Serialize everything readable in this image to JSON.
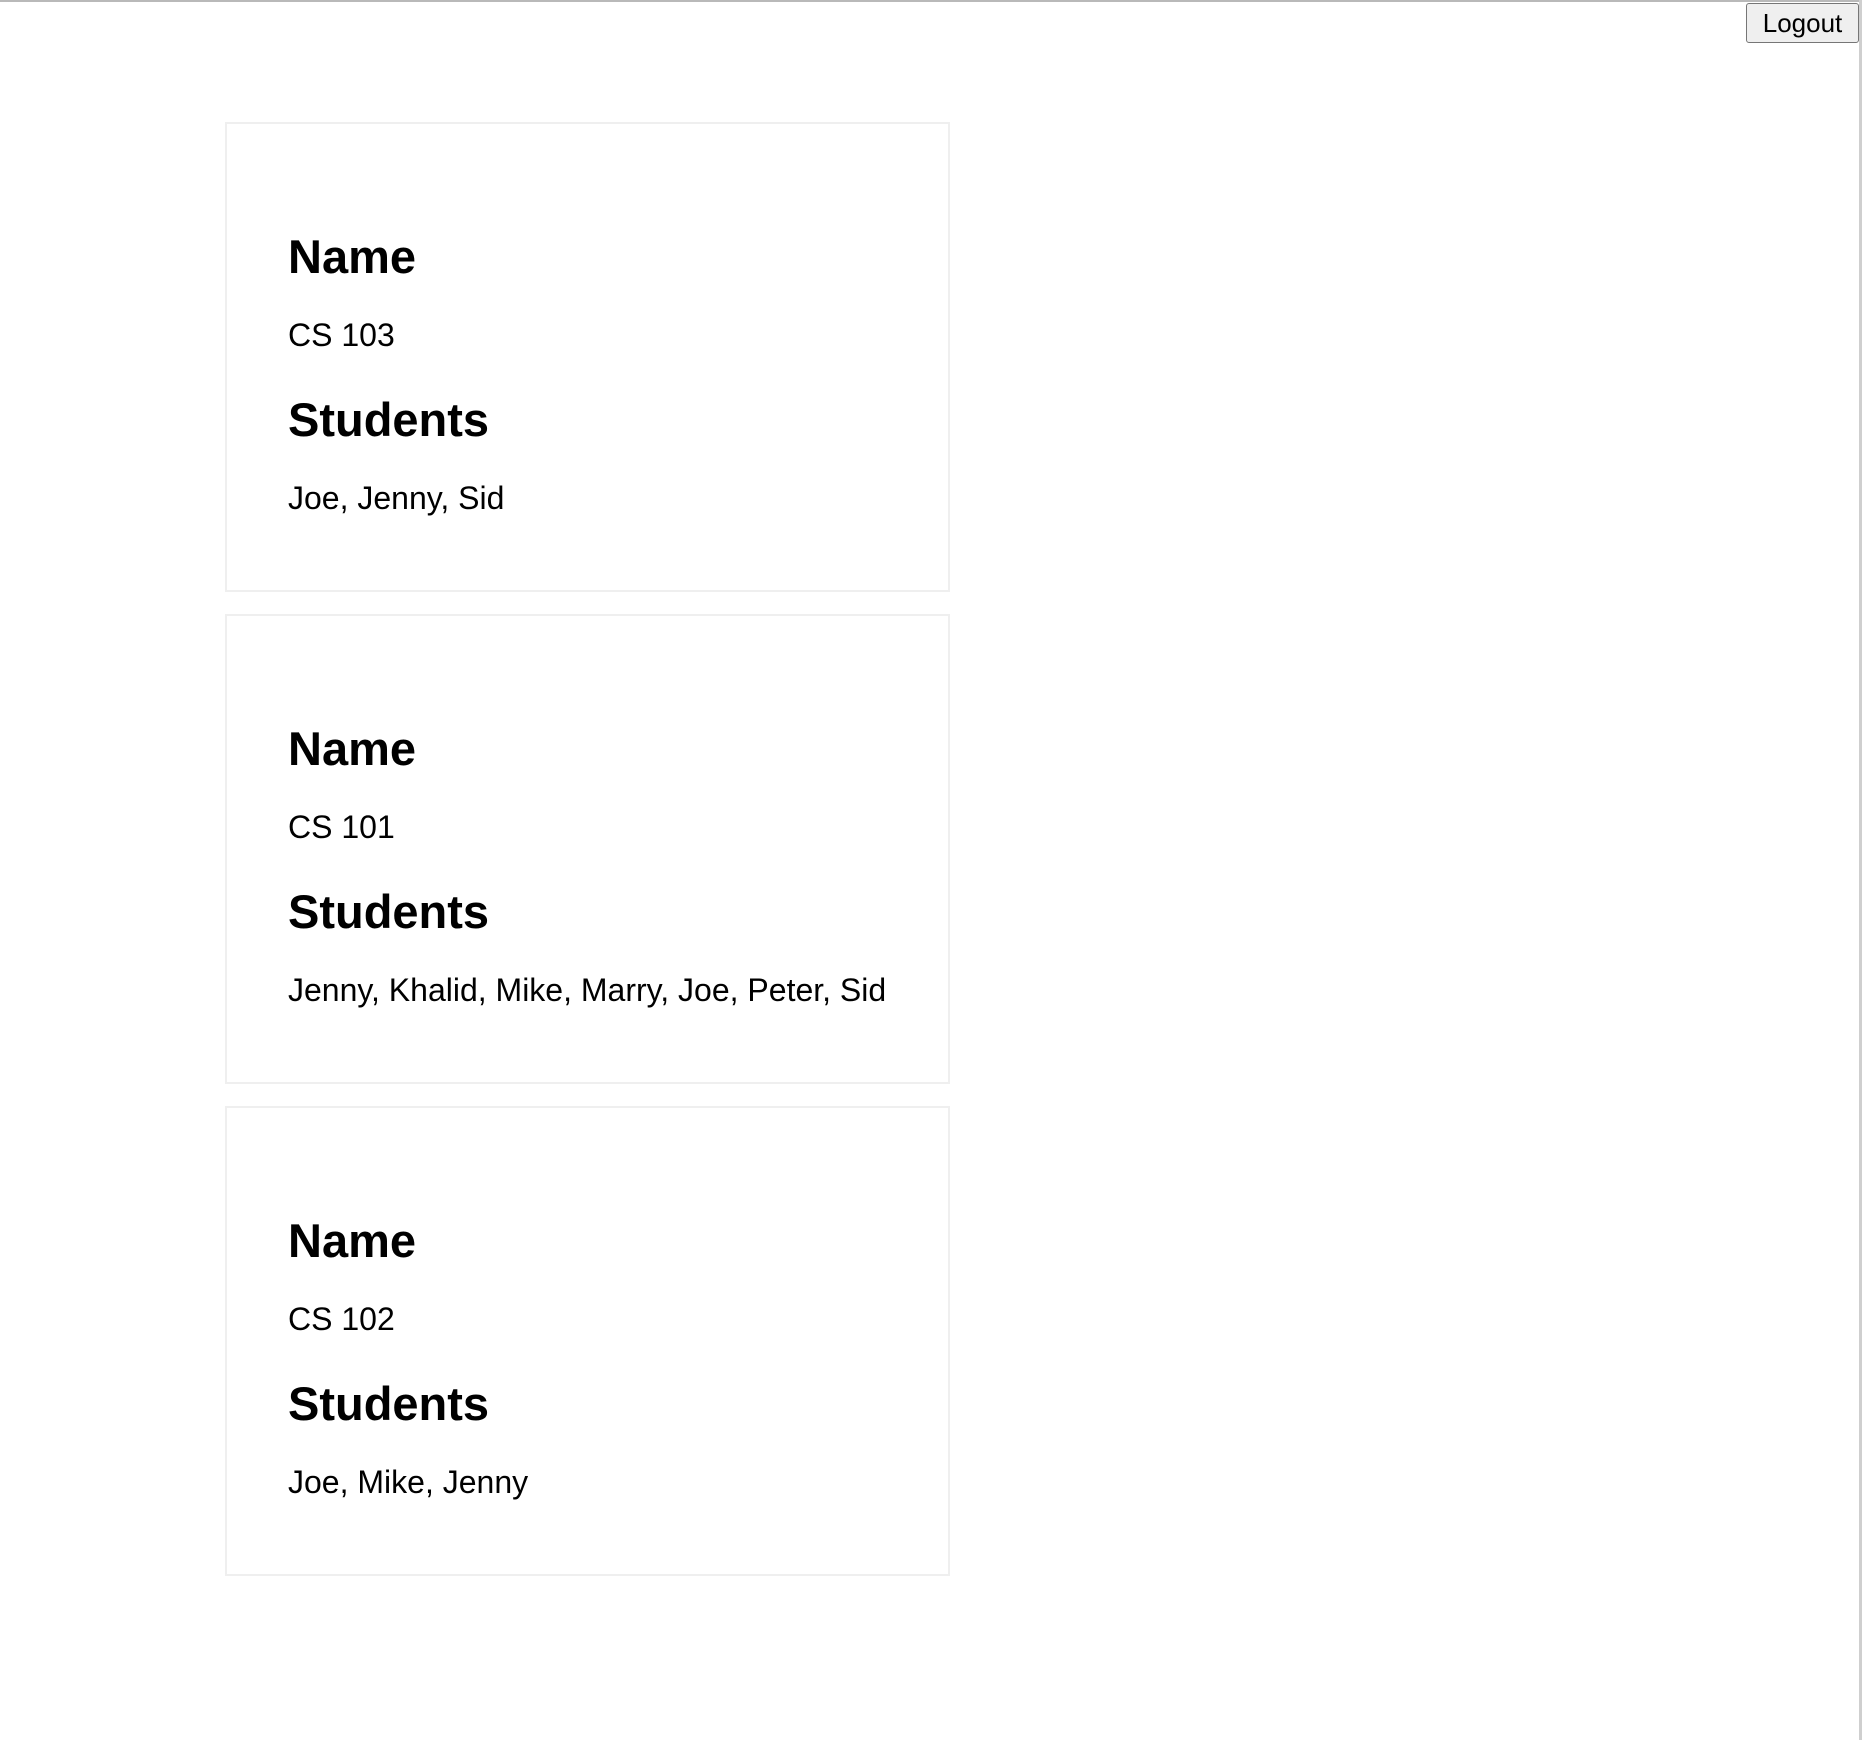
{
  "header": {
    "logout_label": "Logout"
  },
  "courses": [
    {
      "name_heading": "Name",
      "name": "CS 103",
      "students_heading": "Students",
      "students": "Joe, Jenny, Sid"
    },
    {
      "name_heading": "Name",
      "name": "CS 101",
      "students_heading": "Students",
      "students": "Jenny, Khalid, Mike, Marry, Joe, Peter, Sid"
    },
    {
      "name_heading": "Name",
      "name": "CS 102",
      "students_heading": "Students",
      "students": "Joe, Mike, Jenny"
    }
  ]
}
